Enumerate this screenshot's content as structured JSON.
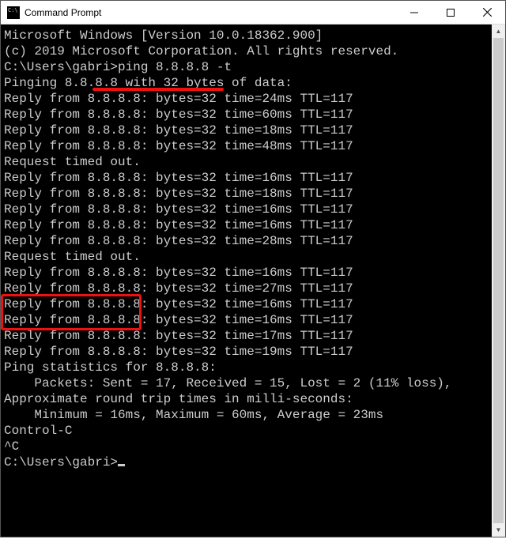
{
  "titlebar": {
    "icon_name": "cmd-icon",
    "title": "Command Prompt",
    "buttons": {
      "min": "minimize",
      "max": "maximize",
      "close": "close"
    }
  },
  "terminal": {
    "header1": "Microsoft Windows [Version 10.0.18362.900]",
    "header2": "(c) 2019 Microsoft Corporation. All rights reserved.",
    "blank": "",
    "prompt1_path": "C:\\Users\\gabri>",
    "prompt1_cmd": "ping 8.8.8.8 -t",
    "pinging": "Pinging 8.8.8.8 with 32 bytes of data:",
    "r1": "Reply from 8.8.8.8: bytes=32 time=24ms TTL=117",
    "r2": "Reply from 8.8.8.8: bytes=32 time=60ms TTL=117",
    "r3": "Reply from 8.8.8.8: bytes=32 time=18ms TTL=117",
    "r4": "Reply from 8.8.8.8: bytes=32 time=48ms TTL=117",
    "t1": "Request timed out.",
    "r5": "Reply from 8.8.8.8: bytes=32 time=16ms TTL=117",
    "r6": "Reply from 8.8.8.8: bytes=32 time=18ms TTL=117",
    "r7": "Reply from 8.8.8.8: bytes=32 time=16ms TTL=117",
    "r8": "Reply from 8.8.8.8: bytes=32 time=16ms TTL=117",
    "r9": "Reply from 8.8.8.8: bytes=32 time=28ms TTL=117",
    "t2": "Request timed out.",
    "r10": "Reply from 8.8.8.8: bytes=32 time=16ms TTL=117",
    "r11": "Reply from 8.8.8.8: bytes=32 time=27ms TTL=117",
    "r12": "Reply from 8.8.8.8: bytes=32 time=16ms TTL=117",
    "r13": "Reply from 8.8.8.8: bytes=32 time=16ms TTL=117",
    "r14": "Reply from 8.8.8.8: bytes=32 time=17ms TTL=117",
    "r15": "Reply from 8.8.8.8: bytes=32 time=19ms TTL=117",
    "stats_hdr": "Ping statistics for 8.8.8.8:",
    "stats_pkt": "    Packets: Sent = 17, Received = 15, Lost = 2 (11% loss),",
    "approx": "Approximate round trip times in milli-seconds:",
    "stats_rtt": "    Minimum = 16ms, Maximum = 60ms, Average = 23ms",
    "ctrlc": "Control-C",
    "caret": "^C",
    "prompt2": "C:\\Users\\gabri>"
  },
  "annotations": {
    "underline_color": "#e11",
    "box_color": "#e11"
  }
}
